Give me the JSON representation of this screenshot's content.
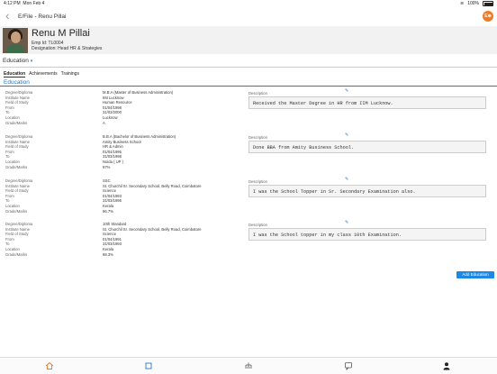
{
  "status": {
    "time": "4:12 PM",
    "date": "Mon Feb 4",
    "battery": "100%"
  },
  "nav": {
    "title": "E/File - Renu Pillai",
    "badge": "E⊕"
  },
  "profile": {
    "name": "Renu M Pillai",
    "emp_id": "Emp Id: TL0004",
    "designation": "Designation: Head HR & Strategies"
  },
  "section": {
    "title": "Education"
  },
  "tabs": [
    "Education",
    "Achievements",
    "Trainings"
  ],
  "subheading": "Education",
  "labels": [
    "Degree/Diploma",
    "Institute Name",
    "Field of Study",
    "From",
    "To",
    "Location",
    "Grade/Marks"
  ],
  "description_label": "Description",
  "records": [
    {
      "values": [
        "M.B.A (Master of Business Administration)",
        "IIM Lucknow",
        "Human Resource",
        "01/04/1998",
        "31/03/2000",
        "Lucknow",
        "A"
      ],
      "description": "Received the Master Degree in HR from IIM Lucknow."
    },
    {
      "values": [
        "B.B.A (Bachelor of Business Administration)",
        "Amity Business School",
        "HR & Admin",
        "01/04/1995",
        "31/03/1998",
        "Noida ( UP )",
        "97%"
      ],
      "description": "Done BBA from Amity Business School."
    },
    {
      "values": [
        "SSC",
        "St. Churchil Sr. Secondary School, Belly Road, Coimbatore",
        "Science",
        "01/04/1993",
        "31/03/1995",
        "Kerala",
        "96.7%"
      ],
      "description": "I was the School Topper in Sr. Secondary Examination also."
    },
    {
      "values": [
        "10th Standard",
        "St. Churchil Sr. Secondary School, Belly Road, Coimbatore",
        "Science",
        "01/04/1991",
        "31/03/1993",
        "Kerala",
        "98.3%"
      ],
      "description": "I was the School topper in my class 10th Examination."
    }
  ],
  "add_button": "Add Education",
  "tabbar": [
    "home-icon",
    "square-icon",
    "org-chart-icon",
    "chat-icon",
    "person-icon"
  ]
}
